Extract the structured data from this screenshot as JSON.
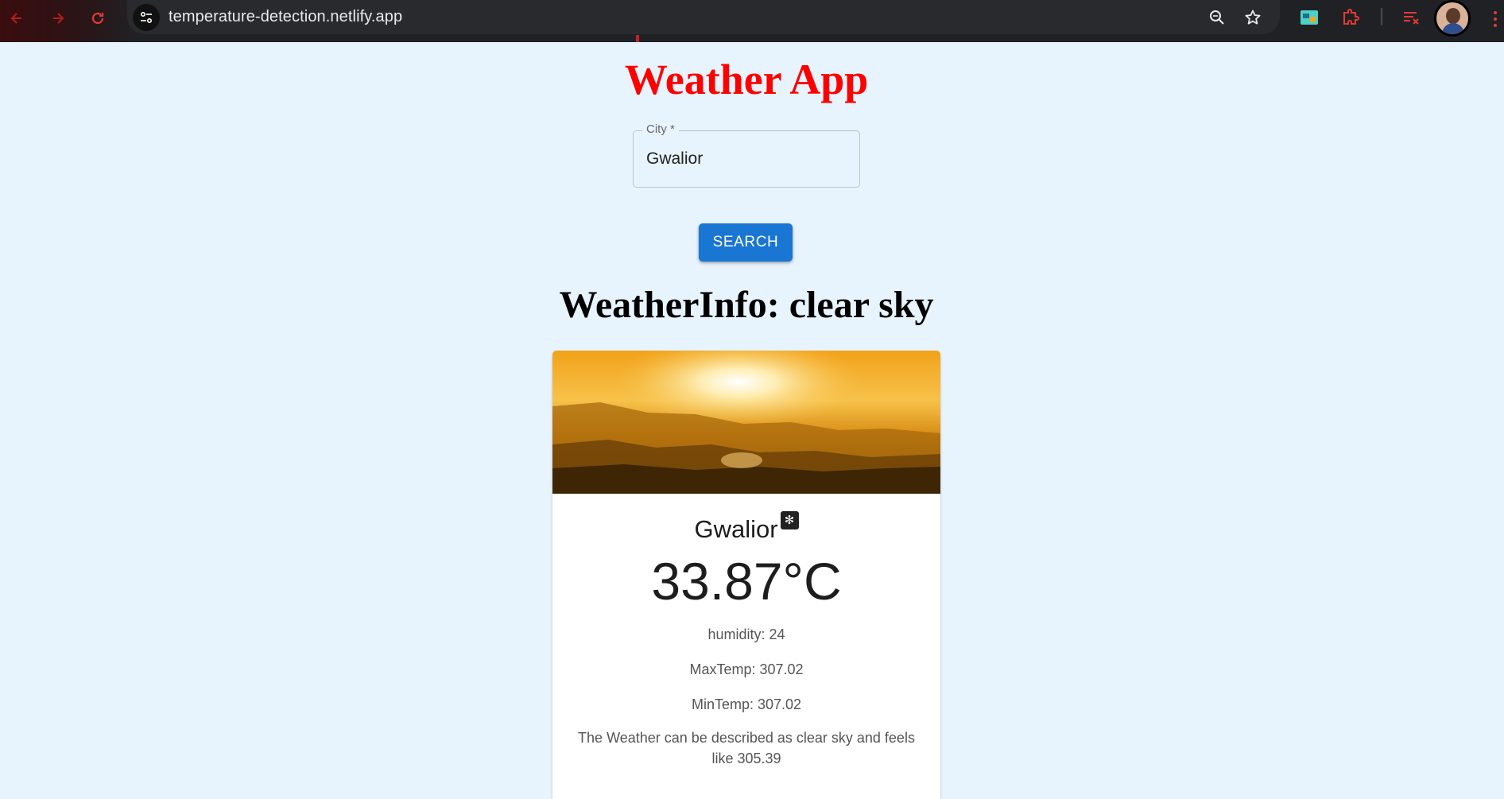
{
  "browser": {
    "url": "temperature-detection.netlify.app",
    "icons": [
      "back-icon",
      "forward-icon",
      "reload-icon",
      "site-info-icon",
      "zoom-icon",
      "bookmark-star-icon",
      "extension-icon",
      "puzzle-extension-icon",
      "reading-list-icon",
      "profile-avatar",
      "menu-icon"
    ]
  },
  "app": {
    "title": "Weather App",
    "search": {
      "label": "City *",
      "value": "Gwalior",
      "button_label": "SEARCH"
    },
    "heading": "WeatherInfo: clear sky",
    "card": {
      "city": "Gwalior",
      "city_icon": "weather-icon",
      "temperature": "33.87°C",
      "humidity": "humidity: 24",
      "max_temp": "MaxTemp: 307.02",
      "min_temp": "MinTemp: 307.02",
      "description": "The Weather can be described as clear sky and feels like 305.39"
    }
  },
  "colors": {
    "title": "#ff0000",
    "button": "#1976d2",
    "page_bg": "#e8f4fd"
  }
}
